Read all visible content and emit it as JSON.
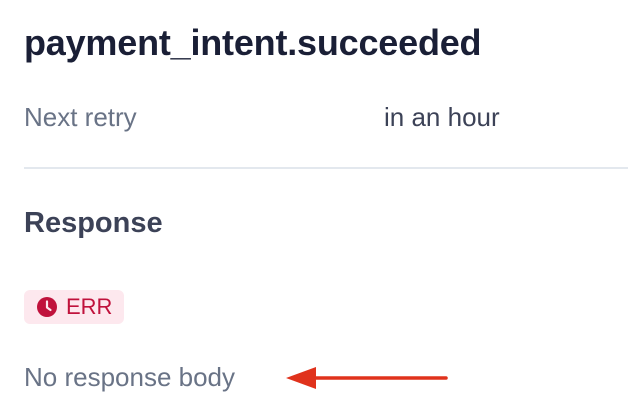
{
  "event": {
    "title": "payment_intent.succeeded"
  },
  "details": {
    "next_retry_label": "Next retry",
    "next_retry_value": "in an hour"
  },
  "response": {
    "section_title": "Response",
    "status_badge": "ERR",
    "status_icon": "clock-icon",
    "body_text": "No response body"
  },
  "colors": {
    "error": "#c0123c",
    "error_bg": "#fde8ee",
    "annotation_arrow": "#e0321c"
  }
}
